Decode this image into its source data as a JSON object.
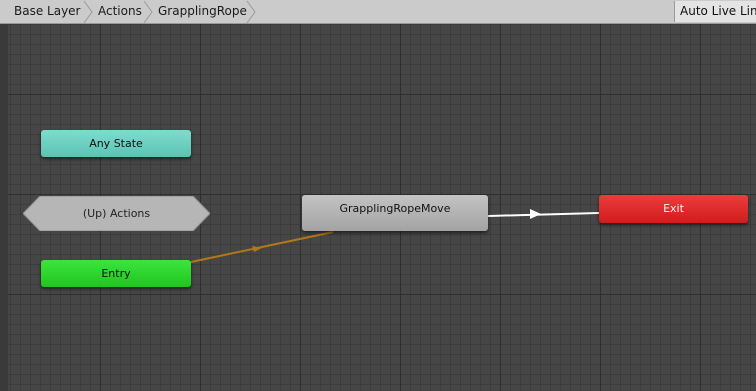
{
  "breadcrumb": {
    "items": [
      "Base Layer",
      "Actions",
      "GrapplingRope"
    ]
  },
  "toolbar": {
    "auto_live_link_label": "Auto Live Link"
  },
  "nodes": {
    "any_state": "Any State",
    "up_actions": "(Up) Actions",
    "entry": "Entry",
    "grappling_rope_move": "GrapplingRopeMove",
    "exit": "Exit"
  },
  "colors": {
    "any_state": "#6fd1c1",
    "entry": "#2ad62a",
    "state": "#b3b3b3",
    "exit": "#e02a2a",
    "entry_transition": "#b07818",
    "transition": "#ffffff"
  }
}
